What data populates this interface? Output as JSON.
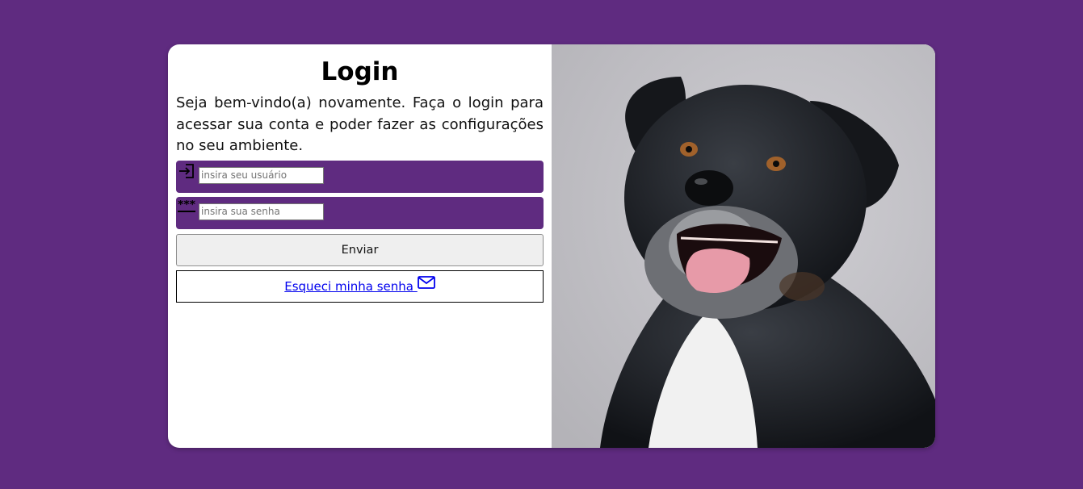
{
  "login": {
    "title": "Login",
    "intro": "Seja bem-vindo(a) novamente. Faça o login para acessar sua conta e poder fazer as configurações no seu ambiente.",
    "username": {
      "icon": "login-arrow-icon",
      "placeholder": "insira seu usuário",
      "value": ""
    },
    "password": {
      "icon": "password-icon",
      "placeholder": "insira sua senha",
      "value": ""
    },
    "submit_label": "Enviar",
    "forgot_label": "Esqueci minha senha ",
    "forgot_icon": "envelope-icon"
  },
  "photo": {
    "subject": "dog-photo"
  },
  "colors": {
    "background": "#5f2b80",
    "card": "#ffffff",
    "link": "#0000ee",
    "photo_backdrop": "#c4c3c8"
  }
}
